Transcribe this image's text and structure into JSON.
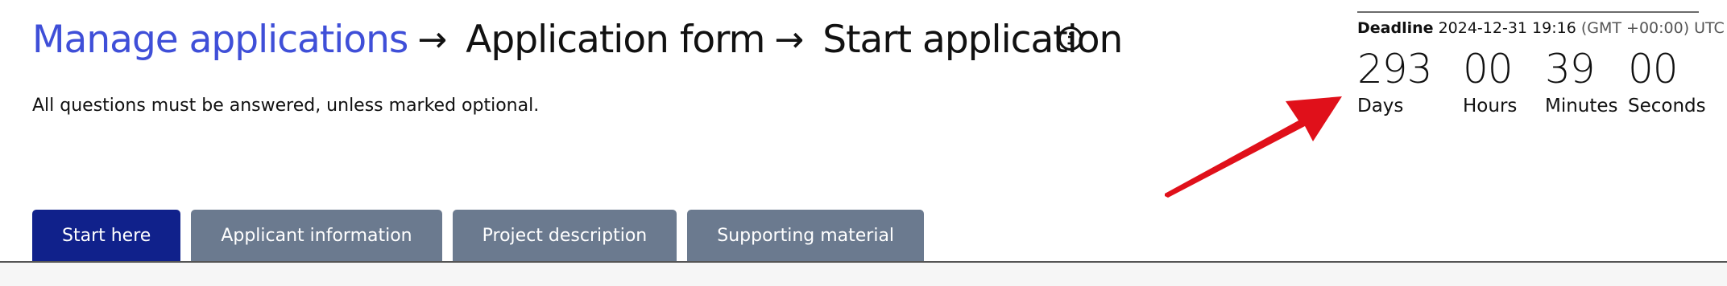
{
  "breadcrumb": {
    "link_label": "Manage applications",
    "arrow_glyph": "→",
    "middle_label": "Application form",
    "current_label": "Start application"
  },
  "info_icon": "info-circle-icon",
  "subtitle": "All questions must be answered, unless marked optional.",
  "deadline": {
    "label": "Deadline",
    "datetime": "2024-12-31 19:16",
    "timezone": "(GMT +00:00) UTC"
  },
  "countdown": [
    {
      "value": "293",
      "unit": "Days"
    },
    {
      "value": "00",
      "unit": "Hours"
    },
    {
      "value": "39",
      "unit": "Minutes"
    },
    {
      "value": "00",
      "unit": "Seconds"
    }
  ],
  "tabs": [
    {
      "label": "Start here",
      "active": true
    },
    {
      "label": "Applicant information",
      "active": false
    },
    {
      "label": "Project description",
      "active": false
    },
    {
      "label": "Supporting material",
      "active": false
    }
  ],
  "colors": {
    "link": "#3f4fd8",
    "active_tab": "#10218b",
    "inactive_tab": "#6b7a8f",
    "annotation_arrow": "#e0101a"
  }
}
